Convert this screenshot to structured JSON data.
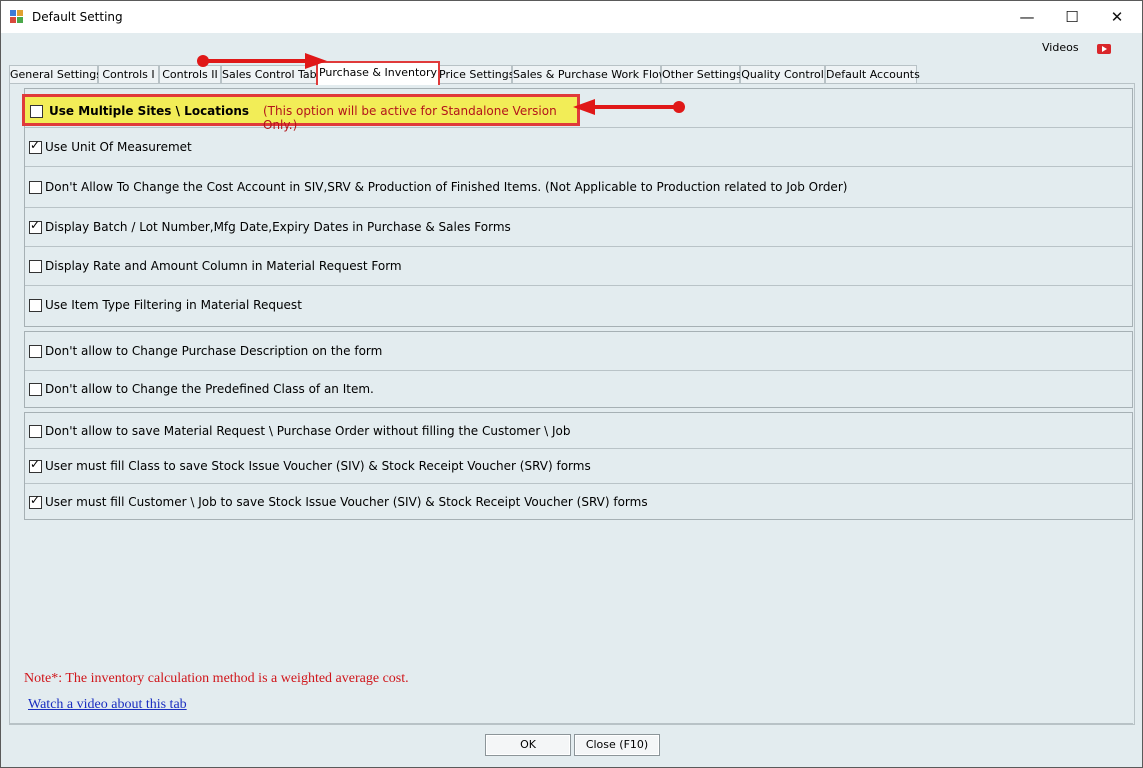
{
  "window": {
    "title": "Default Setting"
  },
  "header": {
    "videos_label": "Videos",
    "videos_icon": "youtube-icon"
  },
  "tabs": [
    {
      "label": "General Settings"
    },
    {
      "label": "Controls I"
    },
    {
      "label": "Controls II"
    },
    {
      "label": "Sales Control Tab"
    },
    {
      "label": "Purchase & Inventory",
      "active": true
    },
    {
      "label": "Price Settings"
    },
    {
      "label": "Sales & Purchase Work Flow"
    },
    {
      "label": "Other Settings"
    },
    {
      "label": "Quality Control"
    },
    {
      "label": "Default Accounts"
    }
  ],
  "highlight": {
    "label": "Use Multiple Sites \\ Locations",
    "note": "(This option will be active for Standalone Version Only.)",
    "checked": false
  },
  "group1": [
    {
      "label": "Use Unit Of Measuremet",
      "checked": true
    },
    {
      "label": "Don't Allow To Change the Cost Account in SIV,SRV & Production of Finished Items. (Not Applicable to Production related to Job Order)",
      "checked": false
    },
    {
      "label": "Display Batch / Lot Number,Mfg Date,Expiry Dates in Purchase & Sales Forms",
      "checked": true
    },
    {
      "label": "Display Rate and Amount Column in Material Request Form",
      "checked": false
    },
    {
      "label": "Use Item Type Filtering in Material Request",
      "checked": false
    }
  ],
  "group2": [
    {
      "label": "Don't allow to Change Purchase Description  on the form",
      "checked": false
    },
    {
      "label": "Don't allow to Change the Predefined Class of an Item.",
      "checked": false
    }
  ],
  "group3": [
    {
      "label": "Don't allow to save Material Request \\ Purchase Order without filling the Customer \\ Job",
      "checked": false
    },
    {
      "label": "User must fill Class to save Stock Issue Voucher (SIV) & Stock Receipt Voucher (SRV) forms",
      "checked": true
    },
    {
      "label": "User must fill Customer \\ Job to save Stock Issue Voucher (SIV) & Stock Receipt Voucher (SRV) forms",
      "checked": true
    }
  ],
  "note": "Note*: The inventory calculation method is a weighted average cost.",
  "video_link": "Watch a video about this tab",
  "buttons": {
    "ok": "OK",
    "close": "Close (F10)"
  },
  "colors": {
    "highlight_bg": "#f2ed57",
    "annotation_red": "#e01818",
    "note_red": "#d0161b",
    "link_blue": "#1a2ec0",
    "panel_bg": "#e3ecef"
  }
}
